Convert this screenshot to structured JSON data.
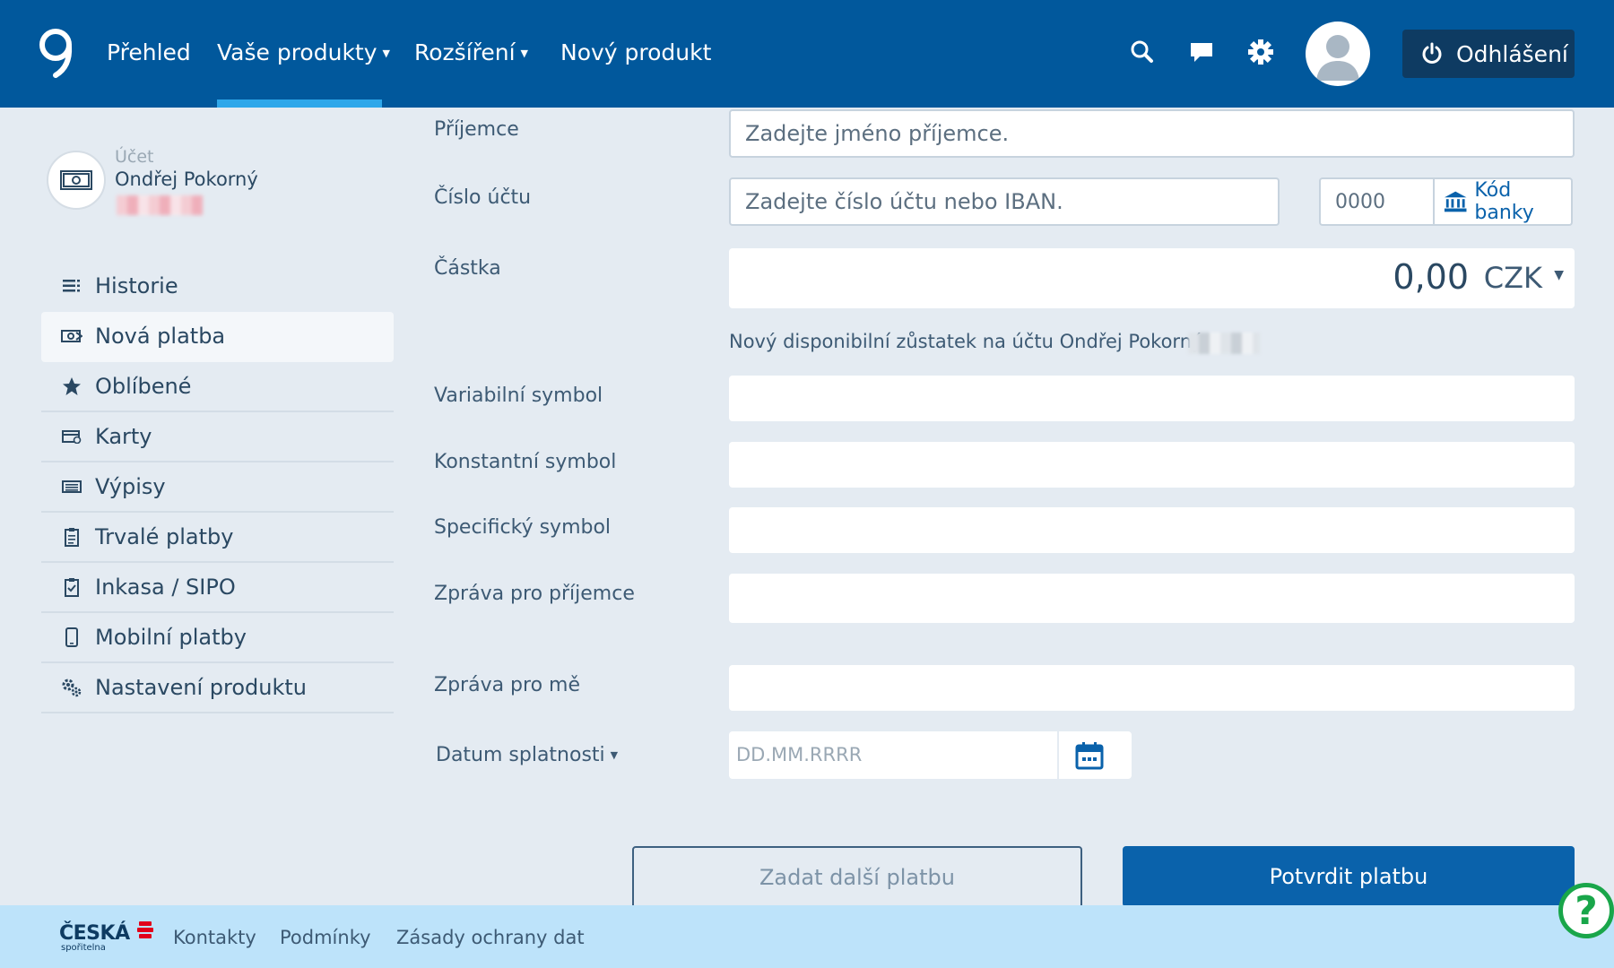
{
  "nav": {
    "items": [
      "Přehled",
      "Vaše produkty",
      "Rozšíření",
      "Nový produkt"
    ],
    "logout": "Odhlášení",
    "icons": [
      "search-icon",
      "chat-icon",
      "gear-icon",
      "user-icon",
      "power-icon"
    ]
  },
  "sidebar": {
    "account_label": "Účet",
    "account_name": "Ondřej Pokorný",
    "items": [
      {
        "label": "Historie",
        "icon": "list-icon"
      },
      {
        "label": "Nová platba",
        "icon": "payment-icon",
        "active": true
      },
      {
        "label": "Oblíbené",
        "icon": "star-icon"
      },
      {
        "label": "Karty",
        "icon": "card-icon"
      },
      {
        "label": "Výpisy",
        "icon": "statement-icon"
      },
      {
        "label": "Trvalé platby",
        "icon": "clipboard-icon"
      },
      {
        "label": "Inkasa / SIPO",
        "icon": "clipboard-check-icon"
      },
      {
        "label": "Mobilní platby",
        "icon": "phone-icon"
      },
      {
        "label": "Nastavení produktu",
        "icon": "gears-icon"
      }
    ]
  },
  "form": {
    "recipient_label": "Příjemce",
    "recipient_placeholder": "Zadejte jméno příjemce.",
    "account_label": "Číslo účtu",
    "account_placeholder": "Zadejte číslo účtu nebo IBAN.",
    "bank_code_placeholder": "0000",
    "bank_code_button": "Kód banky",
    "amount_label": "Částka",
    "amount_value": "0,00",
    "currency": "CZK",
    "balance_note": "Nový disponibilní zůstatek na účtu Ondřej Pokorný :",
    "variable_symbol_label": "Variabilní symbol",
    "constant_symbol_label": "Konstantní symbol",
    "specific_symbol_label": "Specifický symbol",
    "message_recipient_label": "Zpráva pro příjemce",
    "message_me_label": "Zpráva pro mě",
    "due_date_label": "Datum splatnosti",
    "due_date_placeholder": "DD.MM.RRRR",
    "add_another": "Zadat další platbu",
    "confirm": "Potvrdit platbu"
  },
  "footer": {
    "brand": "ČESKÁ",
    "brand_sub": "spořitelna",
    "links": [
      "Kontakty",
      "Podmínky",
      "Zásady ochrany dat"
    ],
    "help": "?"
  },
  "colors": {
    "header": "#01589c",
    "accent": "#2ea7ea",
    "primary_button": "#0a62ab",
    "footer": "#bde3fa",
    "help": "#19a64a",
    "background": "#e4ebf2"
  }
}
